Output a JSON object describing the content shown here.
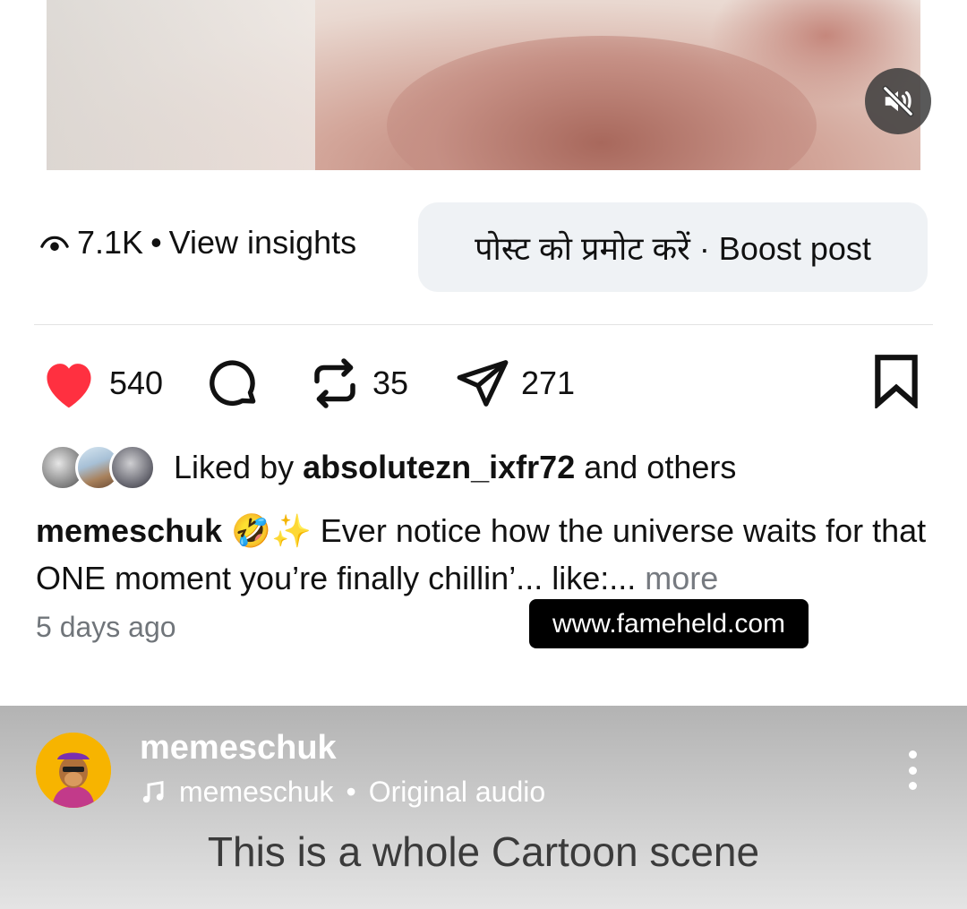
{
  "insights": {
    "views": "7.1K",
    "separator": "•",
    "view_insights_label": "View insights"
  },
  "boost": {
    "label": "पोस्ट को प्रमोट करें · Boost post"
  },
  "actions": {
    "likes": "540",
    "reposts": "35",
    "shares": "271"
  },
  "liked_by": {
    "prefix": "Liked by",
    "user": "absolutezn_ixfr72",
    "suffix": "and others"
  },
  "caption": {
    "username": "memeschuk",
    "emojis": "🤣✨",
    "text": "Ever notice how the universe waits for that ONE moment you’re finally chillin’... like:...",
    "more_label": "more"
  },
  "time_ago": "5 days ago",
  "watermark": "www.fameheld.com",
  "next_post": {
    "username": "memeschuk",
    "audio_user": "memeschuk",
    "audio_sep": "•",
    "audio_label": "Original audio",
    "overlay_text": "This is a whole Cartoon scene"
  },
  "colors": {
    "like_red": "#ff3040",
    "boost_bg": "#eff2f5",
    "watermark_bg": "#000000"
  },
  "icons": {
    "mute": "speaker-muted-icon",
    "views": "eye-icon",
    "like": "heart-filled-icon",
    "comment": "comment-bubble-icon",
    "repost": "repost-icon",
    "share": "send-icon",
    "save": "bookmark-icon",
    "music": "music-note-icon",
    "menu": "more-vertical-icon"
  }
}
